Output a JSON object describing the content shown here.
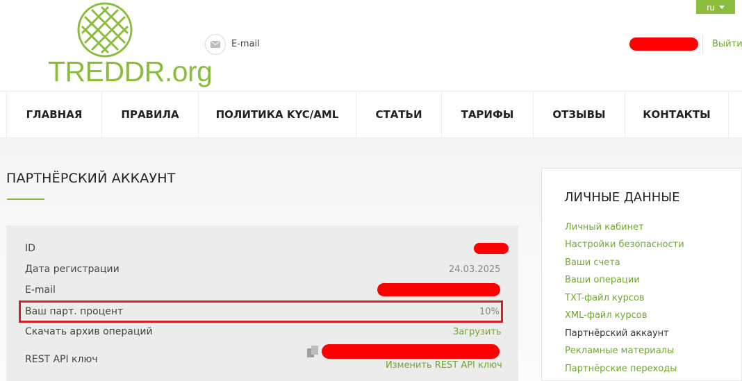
{
  "header": {
    "lang": "ru",
    "logo_text": "TREDDR.org",
    "email_label": "E-mail",
    "logout": "Выйти"
  },
  "nav": {
    "items": [
      "ГЛАВНАЯ",
      "ПРАВИЛА",
      "ПОЛИТИКА KYC/AML",
      "СТАТЬИ",
      "ТАРИФЫ",
      "ОТЗЫВЫ",
      "КОНТАКТЫ"
    ]
  },
  "main": {
    "title": "ПАРТНЁРСКИЙ АККАУНТ",
    "rows": {
      "id_label": "ID",
      "reg_label": "Дата регистрации",
      "reg_value": "24.03.2025",
      "email_label": "E-mail",
      "percent_label": "Ваш парт. процент",
      "percent_value": "10%",
      "archive_label": "Скачать архив операций",
      "archive_link": "Загрузить",
      "api_label": "REST API ключ",
      "api_change": "Изменить REST API ключ"
    }
  },
  "sidebar": {
    "title": "ЛИЧНЫЕ ДАННЫЕ",
    "links": [
      "Личный кабинет",
      "Настройки безопасности",
      "Ваши счета",
      "Ваши операции",
      "TXT-файл курсов",
      "XML-файл курсов",
      "Партнёрский аккаунт",
      "Рекламные материалы",
      "Партнёрские переходы"
    ],
    "active_index": 6
  },
  "colors": {
    "accent": "#8bbd3c",
    "link": "#6fa82f",
    "highlight": "#d81f26",
    "redaction": "#ff0000"
  }
}
